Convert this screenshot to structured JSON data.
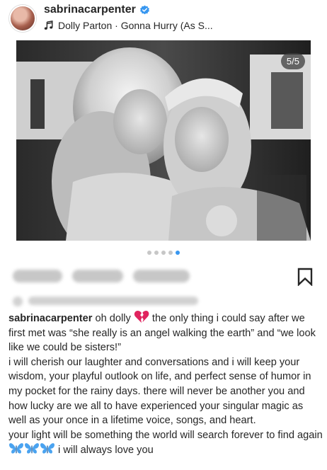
{
  "header": {
    "username": "sabrinacarpenter",
    "audio_text": "Dolly Parton · Gonna Hurry (As S..."
  },
  "post": {
    "counter": "5/5",
    "carousel_total": 5,
    "carousel_active": 5
  },
  "caption": {
    "username": "sabrinacarpenter",
    "line1_a": " oh dolly ",
    "line1_b": "  the only thing i could say after we first met was “she really is an angel walking the earth” and “we look like we could be sisters!”",
    "para2": "i will cherish our laughter and conversations and i will keep your wisdom, your playful outlook on life, and perfect sense of humor in my pocket for the rainy days. there will never be another you and how lucky are we all to have experienced your singular magic as well as your once in a lifetime voice, songs, and heart.",
    "para3_a": "your light will be something the world will search forever to find again ",
    "para3_b": " i will always love you"
  },
  "colors": {
    "verified_blue": "#3897f0",
    "text": "#262626",
    "broken_heart": "#e0245e",
    "butterfly": "#4aa3f0"
  },
  "icons": [
    "verified-badge-icon",
    "music-note-icon",
    "bookmark-icon",
    "broken-heart-icon",
    "butterfly-icon"
  ]
}
